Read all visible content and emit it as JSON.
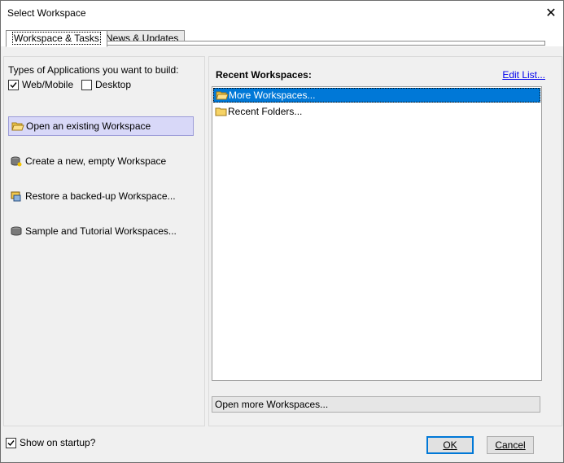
{
  "window": {
    "title": "Select Workspace",
    "close_glyph": "✕"
  },
  "tabs": [
    {
      "label": "Workspace & Tasks",
      "active": true
    },
    {
      "label": "News & Updates",
      "active": false
    }
  ],
  "left": {
    "types_label": "Types of Applications you want to build:",
    "checkboxes": [
      {
        "label": "Web/Mobile",
        "checked": true
      },
      {
        "label": "Desktop",
        "checked": false
      }
    ],
    "actions": [
      {
        "label": "Open an existing Workspace",
        "icon": "open-folder-icon",
        "selected": true
      },
      {
        "label": "Create a new, empty Workspace",
        "icon": "new-database-icon",
        "selected": false
      },
      {
        "label": "Restore a backed-up Workspace...",
        "icon": "restore-icon",
        "selected": false
      },
      {
        "label": "Sample and Tutorial Workspaces...",
        "icon": "database-icon",
        "selected": false
      }
    ]
  },
  "right": {
    "title": "Recent Workspaces:",
    "edit_link": "Edit List...",
    "items": [
      {
        "label": "More Workspaces...",
        "icon": "open-folder-icon",
        "selected": true
      },
      {
        "label": "Recent Folders...",
        "icon": "folder-icon",
        "selected": false
      }
    ],
    "open_more_label": "Open more Workspaces..."
  },
  "footer": {
    "show_on_startup": {
      "label": "Show on startup?",
      "checked": true
    },
    "ok_label": "OK",
    "cancel_label": "Cancel"
  },
  "colors": {
    "selection": "#0078d7",
    "action_selected": "#d8d8f8",
    "link": "#0000ee"
  }
}
